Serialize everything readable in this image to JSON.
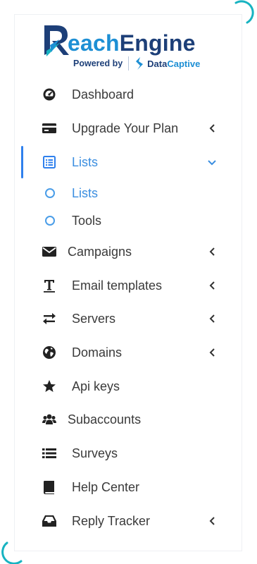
{
  "logo": {
    "brand_part1": "R",
    "brand_part2": "each",
    "brand_part3": "Engine",
    "powered_by": "Powered by",
    "partner_part1": "Data",
    "partner_part2": "Captive"
  },
  "colors": {
    "accent": "#2f80ed",
    "sub_active": "#3b8ee0",
    "text": "#3a3a3a",
    "teal": "#17b3c1"
  },
  "sidebar": {
    "items": [
      {
        "label": "Dashboard",
        "icon": "dashboard-gauge-icon"
      },
      {
        "label": "Upgrade Your Plan",
        "icon": "credit-card-icon"
      },
      {
        "label": "Lists",
        "icon": "list-alt-icon"
      },
      {
        "label": "Campaigns",
        "icon": "envelope-icon"
      },
      {
        "label": "Email templates",
        "icon": "text-format-icon"
      },
      {
        "label": "Servers",
        "icon": "exchange-icon"
      },
      {
        "label": "Domains",
        "icon": "globe-icon"
      },
      {
        "label": "Api keys",
        "icon": "star-icon"
      },
      {
        "label": "Subaccounts",
        "icon": "users-icon"
      },
      {
        "label": "Surveys",
        "icon": "list-icon"
      },
      {
        "label": "Help Center",
        "icon": "book-icon"
      },
      {
        "label": "Reply Tracker",
        "icon": "inbox-icon"
      }
    ],
    "lists_submenu": [
      {
        "label": "Lists"
      },
      {
        "label": "Tools"
      }
    ]
  }
}
